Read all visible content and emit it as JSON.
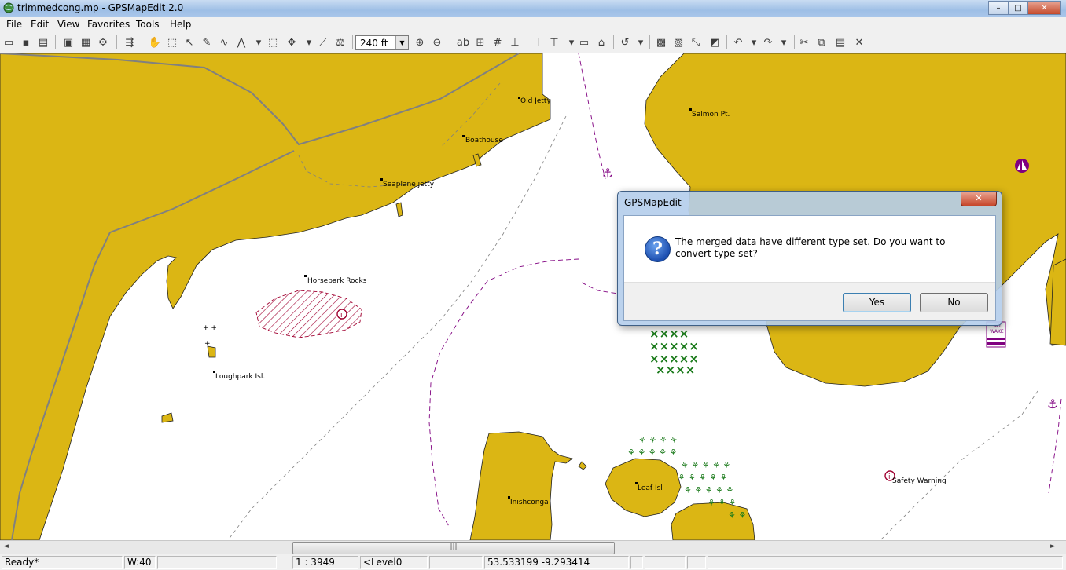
{
  "window": {
    "title": "trimmedcong.mp - GPSMapEdit 2.0",
    "controls": {
      "minimize": "–",
      "maximize": "□",
      "close": "✕"
    }
  },
  "menu": [
    "File",
    "Edit",
    "View",
    "Favorites",
    "Tools",
    "Help"
  ],
  "toolbar": {
    "scale_value": "240 ft",
    "dropdown_glyph": "▼"
  },
  "map": {
    "labels": {
      "old_jetty": "Old Jetty",
      "boathouse": "Boathouse",
      "seaplane_jetty": "Seaplane jetty",
      "salmon_pt": "Salmon Pt.",
      "horsepark_rocks": "Horsepark Rocks",
      "loughpark_isl": "Loughpark Isl.",
      "inishconga": "Inishconga",
      "leaf_isl": "Leaf Isl",
      "safety_warning": "Safety Warning",
      "no_wake_sign": "NO WAKE"
    },
    "colors": {
      "land": "#dbb614",
      "water": "#ffffff",
      "track": "#808080",
      "boundary": "#800080",
      "vegetation": "#1a7a1a",
      "hazard": "#a00030"
    }
  },
  "dialog": {
    "title": "GPSMapEdit",
    "message": "The merged data have different type set. Do you want to convert type set?",
    "icon_glyph": "?",
    "yes_label": "Yes",
    "no_label": "No",
    "close_glyph": "✕"
  },
  "scrollbar": {
    "grip": "|||",
    "left_arrow": "◄",
    "right_arrow": "►"
  },
  "status": {
    "state": "Ready*",
    "width": "W:40",
    "scale": "1 : 3949",
    "level": "<Level0",
    "coords": "53.533199 -9.293414"
  }
}
